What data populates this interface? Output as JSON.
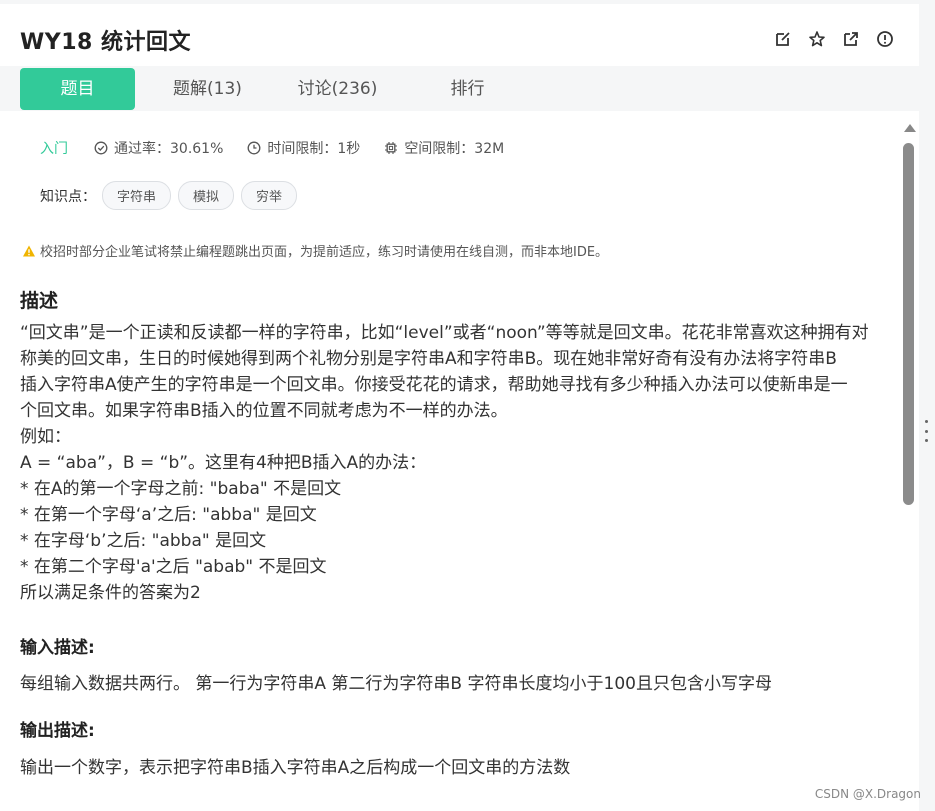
{
  "header": {
    "title": "WY18  统计回文"
  },
  "tabs": [
    {
      "label": "题目",
      "active": true
    },
    {
      "label": "题解(13)",
      "active": false
    },
    {
      "label": "讨论(236)",
      "active": false
    },
    {
      "label": "排行",
      "active": false
    }
  ],
  "meta": {
    "level": "入门",
    "pass_rate": "通过率：30.61%",
    "time_limit": "时间限制：1秒",
    "space_limit": "空间限制：32M"
  },
  "knowledge": {
    "label": "知识点：",
    "tags": [
      "字符串",
      "模拟",
      "穷举"
    ]
  },
  "warning": "校招时部分企业笔试将禁止编程题跳出页面，为提前适应，练习时请使用在线自测，而非本地IDE。",
  "description": {
    "heading": "描述",
    "lines": [
      "“回文串”是一个正读和反读都一样的字符串，比如“level”或者“noon”等等就是回文串。花花非常喜欢这种拥有对",
      "称美的回文串，生日的时候她得到两个礼物分别是字符串A和字符串B。现在她非常好奇有没有办法将字符串B",
      "插入字符串A使产生的字符串是一个回文串。你接受花花的请求，帮助她寻找有多少种插入办法可以使新串是一",
      "个回文串。如果字符串B插入的位置不同就考虑为不一样的办法。",
      "例如：",
      "A = “aba”，B = “b”。这里有4种把B插入A的办法：",
      "* 在A的第一个字母之前: \"baba\" 不是回文",
      "* 在第一个字母‘a’之后: \"abba\" 是回文",
      "* 在字母‘b’之后: \"abba\" 是回文",
      "* 在第二个字母'a'之后 \"abab\" 不是回文",
      "所以满足条件的答案为2"
    ]
  },
  "input_desc": {
    "heading": "输入描述:",
    "text": "每组输入数据共两行。 第一行为字符串A 第二行为字符串B 字符串长度均小于100且只包含小写字母"
  },
  "output_desc": {
    "heading": "输出描述:",
    "text": "输出一个数字，表示把字符串B插入字符串A之后构成一个回文串的方法数"
  },
  "watermark": "CSDN @X.Dragon",
  "colors": {
    "accent": "#32ca99",
    "warning": "#f0b400"
  }
}
